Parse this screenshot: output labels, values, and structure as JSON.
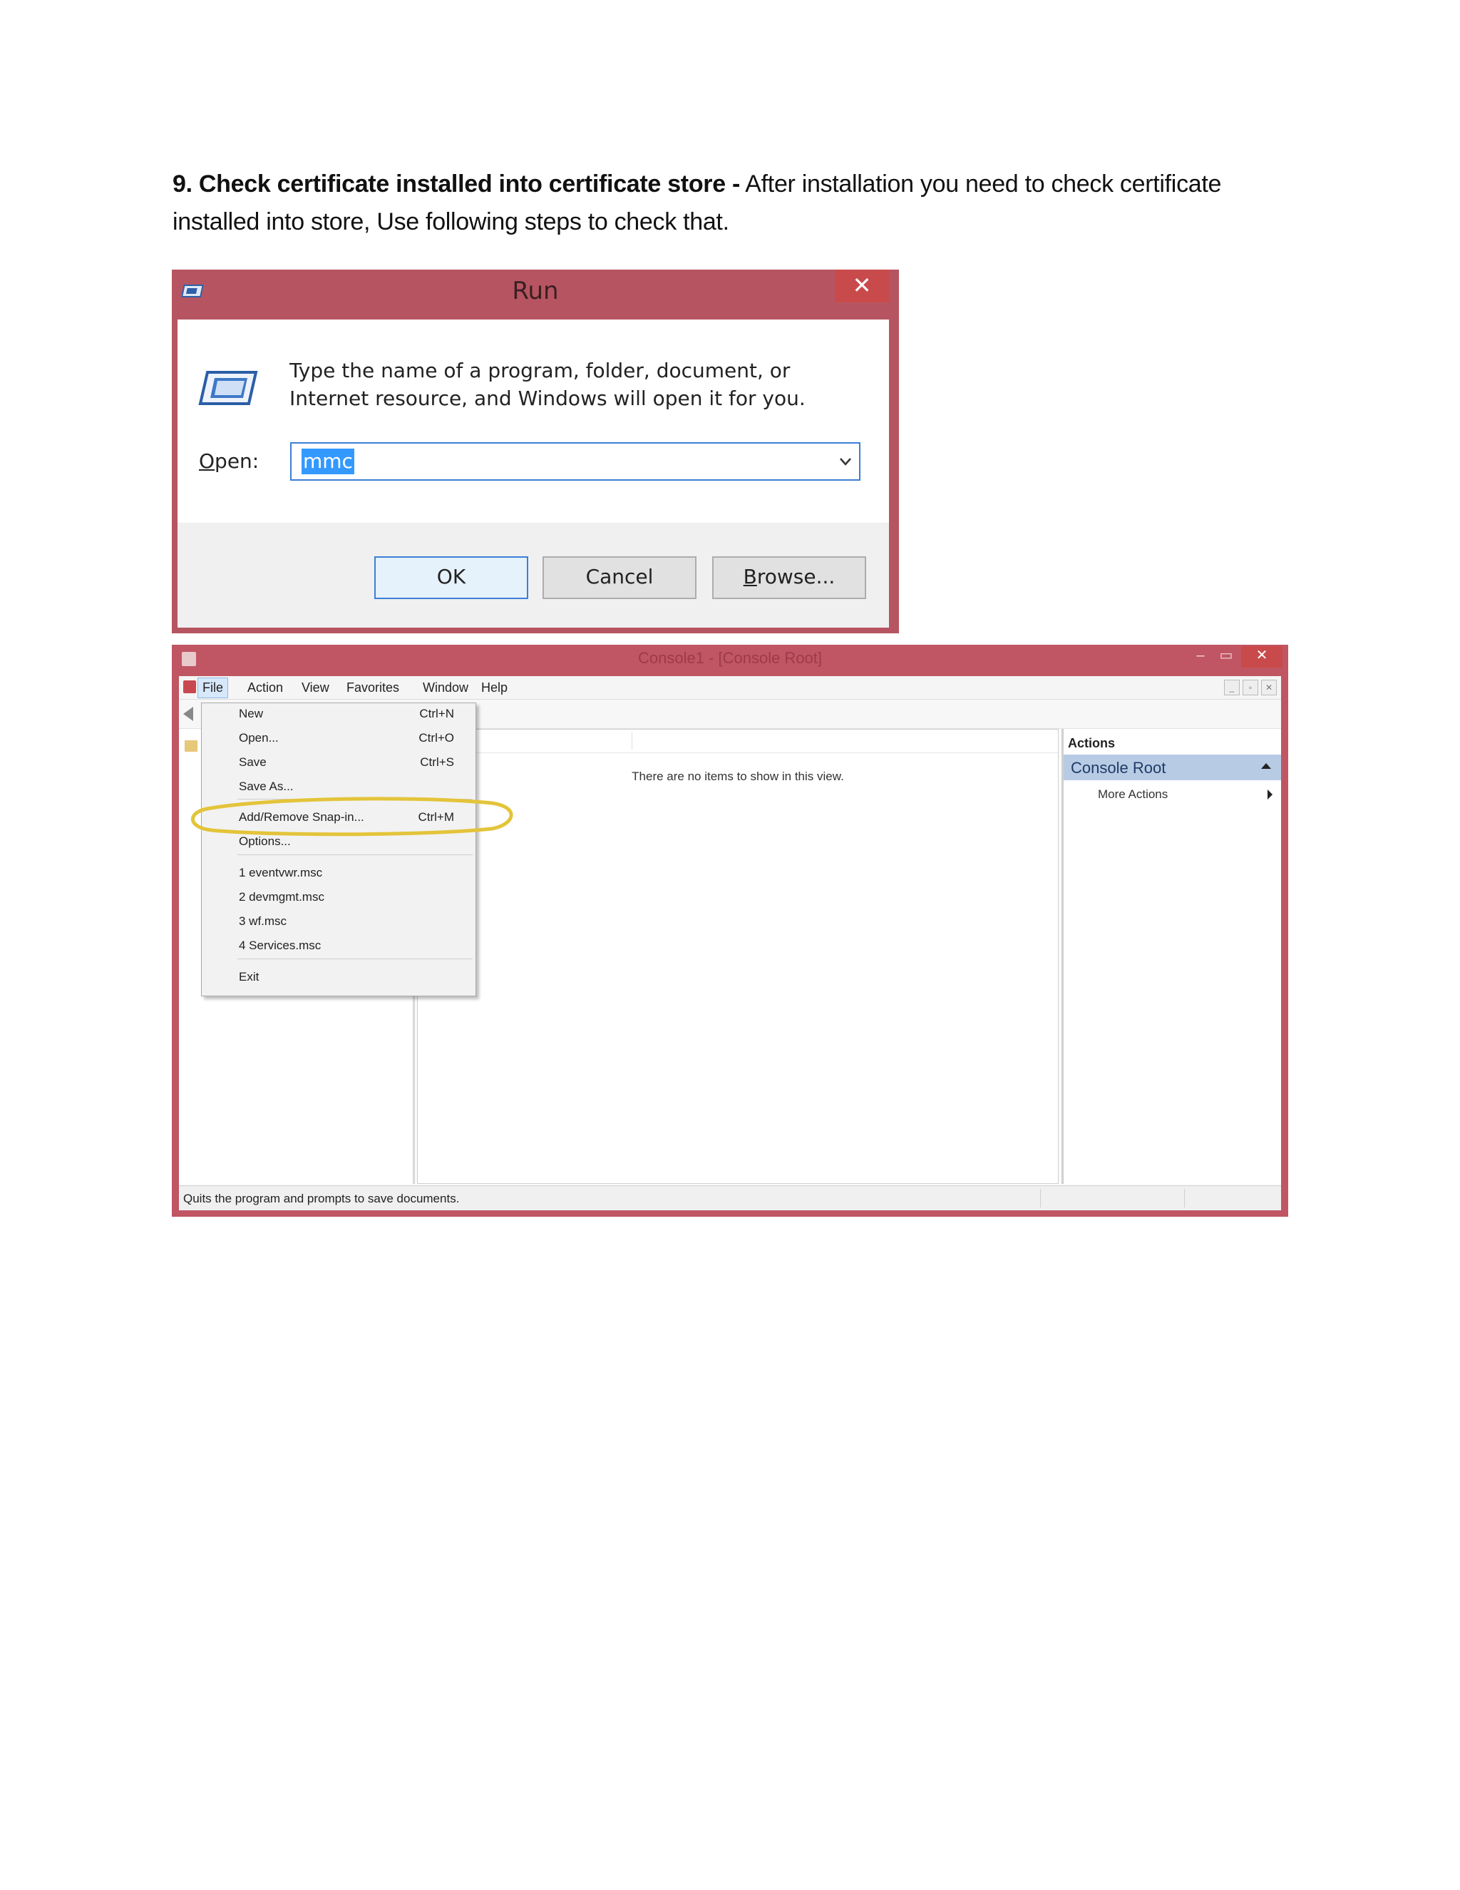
{
  "heading": {
    "bold": "9. Check certificate installed  into certificate store -",
    "rest": " After installation you need to check certificate installed into store, Use following steps to check that."
  },
  "run_dialog": {
    "title": "Run",
    "close_glyph": "✕",
    "instruction": "Type the name of a program, folder, document, or Internet resource, and Windows will open it for you.",
    "open_label_accel": "O",
    "open_label_rest": "pen:",
    "input_value": "mmc",
    "ok_label": "OK",
    "cancel_label": "Cancel",
    "browse_label_accel": "B",
    "browse_label_rest": "rowse...",
    "accent_color": "#b65561"
  },
  "mmc_window": {
    "title": "Console1 - [Console Root]",
    "menu": [
      "File",
      "Action",
      "View",
      "Favorites",
      "Window",
      "Help"
    ],
    "file_menu": [
      {
        "label": "New",
        "shortcut": "Ctrl+N"
      },
      {
        "label": "Open...",
        "shortcut": "Ctrl+O"
      },
      {
        "label": "Save",
        "shortcut": "Ctrl+S"
      },
      {
        "label": "Save As...",
        "shortcut": ""
      },
      {
        "label": "Add/Remove Snap-in...",
        "shortcut": "Ctrl+M"
      },
      {
        "label": "Options...",
        "shortcut": ""
      },
      {
        "label": "1 eventvwr.msc",
        "shortcut": ""
      },
      {
        "label": "2 devmgmt.msc",
        "shortcut": ""
      },
      {
        "label": "3 wf.msc",
        "shortcut": ""
      },
      {
        "label": "4 Services.msc",
        "shortcut": ""
      },
      {
        "label": "Exit",
        "shortcut": ""
      }
    ],
    "empty_message": "There are no items to show in this view.",
    "actions_header": "Actions",
    "actions_root": "Console Root",
    "more_actions": "More Actions",
    "status_text": "Quits the program and prompts to save documents.",
    "highlight_color": "#e3c43a"
  }
}
